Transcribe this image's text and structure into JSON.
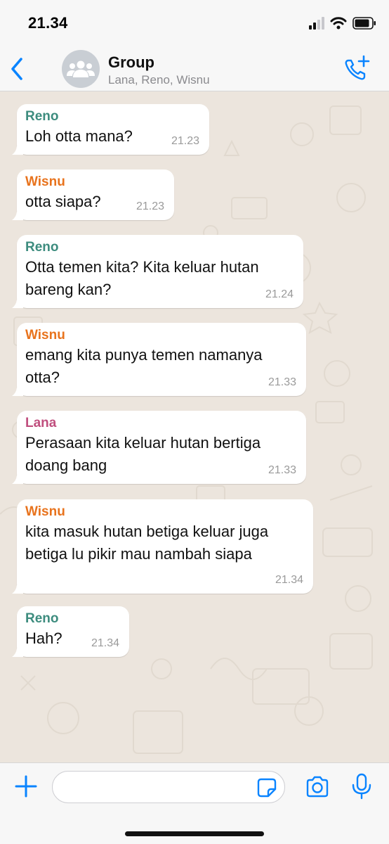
{
  "status_bar": {
    "time": "21.34",
    "icons": [
      "cellular-signal-icon",
      "wifi-icon",
      "battery-icon"
    ]
  },
  "header": {
    "title": "Group",
    "subtitle": "Lana, Reno, Wisnu",
    "back_icon": "chevron-left-icon",
    "avatar_icon": "group-people-icon",
    "action_icon": "add-call-icon"
  },
  "colors": {
    "accent": "#0a84ff",
    "sender_reno": "#3d8c7e",
    "sender_wisnu": "#e8731d",
    "sender_lana": "#c04f7e",
    "bubble": "#ffffff",
    "wallpaper": "#ece5dd"
  },
  "messages": [
    {
      "sender": "Reno",
      "text": "Loh otta mana?",
      "time": "21.23"
    },
    {
      "sender": "Wisnu",
      "text": "otta siapa?",
      "time": "21.23"
    },
    {
      "sender": "Reno",
      "text": "Otta temen kita? Kita keluar hutan bareng kan?",
      "time": "21.24"
    },
    {
      "sender": "Wisnu",
      "text": "emang kita punya temen namanya otta?",
      "time": "21.33"
    },
    {
      "sender": "Lana",
      "text": "Perasaan kita keluar hutan bertiga doang bang",
      "time": "21.33"
    },
    {
      "sender": "Wisnu",
      "text": "kita masuk hutan betiga keluar juga betiga lu pikir mau nambah siapa",
      "time": "21.34"
    },
    {
      "sender": "Reno",
      "text": "Hah?",
      "time": "21.34"
    }
  ],
  "input_bar": {
    "placeholder": "",
    "icons": [
      "plus-icon",
      "sticker-icon",
      "camera-icon",
      "microphone-icon"
    ]
  }
}
